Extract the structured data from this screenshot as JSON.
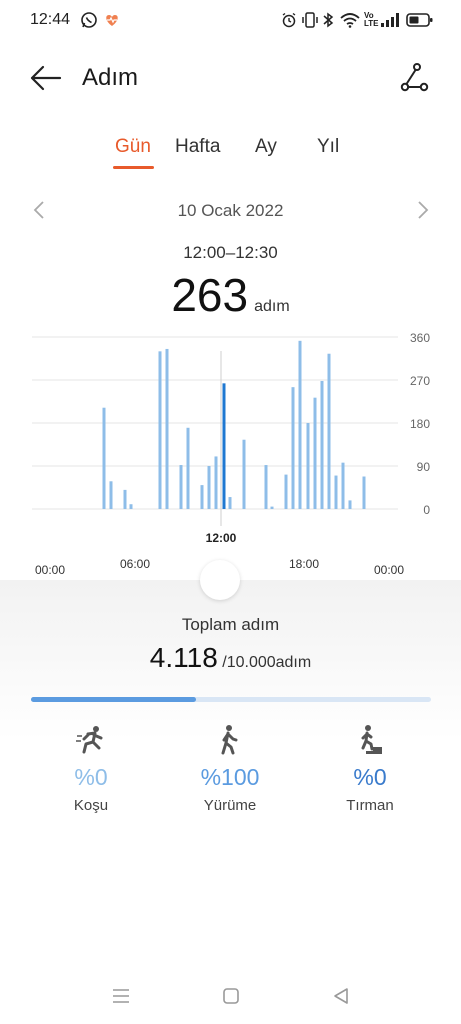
{
  "status_bar": {
    "time": "12:44",
    "icons": [
      "whatsapp-icon",
      "health-heart-icon",
      "alarm-icon",
      "vibrate-icon",
      "bluetooth-icon",
      "wifi-icon",
      "volte-icon",
      "signal-icon",
      "battery-icon"
    ],
    "volte_text": "Vo LTE"
  },
  "header": {
    "title": "Adım",
    "back_icon": "arrow-left-icon",
    "route_icon": "route-icon"
  },
  "tabs": [
    {
      "label": "Gün",
      "active": true
    },
    {
      "label": "Hafta",
      "active": false
    },
    {
      "label": "Ay",
      "active": false
    },
    {
      "label": "Yıl",
      "active": false
    }
  ],
  "date_nav": {
    "label": "10 Ocak 2022",
    "prev_icon": "chevron-left-icon",
    "next_icon": "chevron-right-icon"
  },
  "selection": {
    "range": "12:00–12:30",
    "value": "263",
    "unit": "adım"
  },
  "chart_data": {
    "type": "bar",
    "ylim": [
      0,
      360
    ],
    "y_ticks": [
      "0",
      "90",
      "180",
      "270",
      "360"
    ],
    "x_tick_labels": [
      "00:00",
      "06:00",
      "12:00",
      "18:00",
      "00:00"
    ],
    "selected_label": "12:00",
    "selected_index": 24,
    "bar_color": "#8ebde8",
    "selected_color": "#1f78d1",
    "values": [
      0,
      0,
      0,
      0,
      0,
      0,
      0,
      0,
      0,
      0,
      0,
      0,
      0,
      0,
      0,
      0,
      0,
      0,
      0,
      0,
      0,
      0,
      0,
      0,
      0,
      0,
      0,
      0,
      0,
      0,
      0,
      0,
      0,
      0,
      0,
      0,
      0,
      0,
      0,
      0,
      0,
      0,
      0,
      0,
      0,
      0,
      0,
      0,
      0,
      0,
      0,
      0,
      0,
      0,
      0,
      0,
      0,
      0
    ]
  },
  "chart_bars": [
    {
      "x": 104,
      "v": 212
    },
    {
      "x": 111,
      "v": 58
    },
    {
      "x": 125,
      "v": 40
    },
    {
      "x": 131,
      "v": 10
    },
    {
      "x": 160,
      "v": 330
    },
    {
      "x": 167,
      "v": 335
    },
    {
      "x": 181,
      "v": 92
    },
    {
      "x": 188,
      "v": 170
    },
    {
      "x": 202,
      "v": 50
    },
    {
      "x": 209,
      "v": 90
    },
    {
      "x": 216,
      "v": 110
    },
    {
      "x": 224,
      "v": 263
    },
    {
      "x": 230,
      "v": 25
    },
    {
      "x": 244,
      "v": 145
    },
    {
      "x": 266,
      "v": 92
    },
    {
      "x": 272,
      "v": 5
    },
    {
      "x": 286,
      "v": 72
    },
    {
      "x": 293,
      "v": 255
    },
    {
      "x": 300,
      "v": 352
    },
    {
      "x": 308,
      "v": 180
    },
    {
      "x": 315,
      "v": 233
    },
    {
      "x": 322,
      "v": 268
    },
    {
      "x": 329,
      "v": 325
    },
    {
      "x": 336,
      "v": 70
    },
    {
      "x": 343,
      "v": 97
    },
    {
      "x": 350,
      "v": 18
    },
    {
      "x": 364,
      "v": 68
    }
  ],
  "summary": {
    "label": "Toplam adım",
    "total": "4.118",
    "goal": "/10.000adım",
    "progress": 0.4118
  },
  "activities": [
    {
      "name": "Koşu",
      "percent": "%0",
      "icon": "running-icon",
      "color": "#8ebde8"
    },
    {
      "name": "Yürüme",
      "percent": "%100",
      "icon": "walking-icon",
      "color": "#5b9be0"
    },
    {
      "name": "Tırman",
      "percent": "%0",
      "icon": "climbing-icon",
      "color": "#3a7bcc"
    }
  ],
  "nav_bar": {
    "icons": [
      "menu-icon",
      "home-square-icon",
      "back-triangle-icon"
    ]
  }
}
